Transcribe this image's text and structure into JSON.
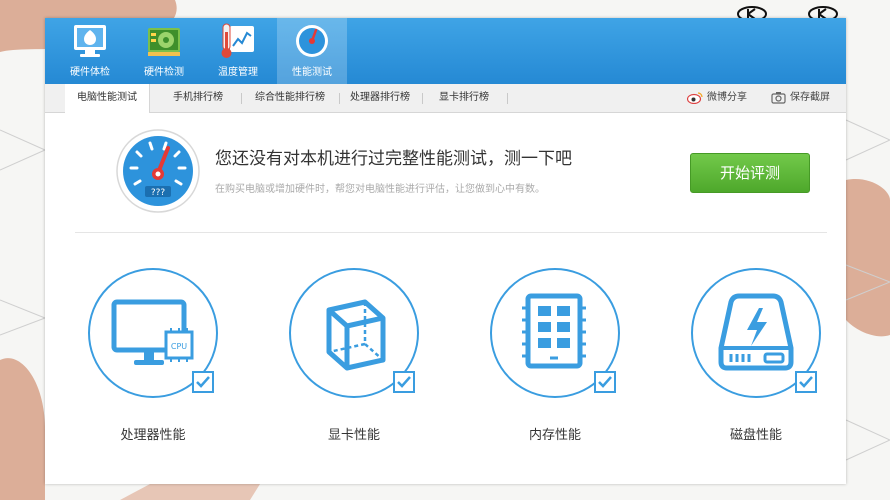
{
  "top_tabs": [
    {
      "label": "硬件体检",
      "icon": "monitor-shield-icon"
    },
    {
      "label": "硬件检测",
      "icon": "hardware-board-icon"
    },
    {
      "label": "温度管理",
      "icon": "thermometer-chart-icon"
    },
    {
      "label": "性能测试",
      "icon": "speedometer-icon",
      "active": true
    }
  ],
  "sub_tabs": [
    {
      "label": "电脑性能测试",
      "active": true
    },
    {
      "label": "手机排行榜"
    },
    {
      "label": "综合性能排行榜"
    },
    {
      "label": "处理器排行榜"
    },
    {
      "label": "显卡排行榜"
    }
  ],
  "tools": {
    "share": "微博分享",
    "screenshot": "保存截屏"
  },
  "test_panel": {
    "headline": "您还没有对本机进行过完整性能测试，测一下吧",
    "description": "在购买电脑或增加硬件时，帮您对电脑性能进行评估，让您做到心中有数。",
    "gauge_text": "???",
    "start_button": "开始评测"
  },
  "categories": [
    {
      "label": "处理器性能",
      "icon": "cpu-monitor-icon",
      "icon_text": "CPU",
      "checked": true
    },
    {
      "label": "显卡性能",
      "icon": "gpu-cube-icon",
      "checked": true
    },
    {
      "label": "内存性能",
      "icon": "memory-chip-icon",
      "checked": true
    },
    {
      "label": "磁盘性能",
      "icon": "disk-drive-icon",
      "checked": true
    }
  ],
  "colors": {
    "accent": "#2d93dc",
    "start_button": "#5cb532",
    "gauge_needle": "#e53935"
  }
}
